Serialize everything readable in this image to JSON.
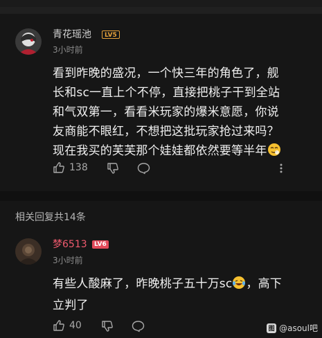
{
  "comment1": {
    "username": "青花瑶池",
    "level_badge": "LV5",
    "time": "3小时前",
    "text_lines": [
      "看到昨晚的盛况，一个快三年的角色了，舰",
      "长和sc一直上个不停，直接把桃子干到全站",
      "和气双第一，看看米玩家的爆米意愿，你说",
      "友商能不眼红，不想把这批玩家抢过来吗？",
      "现在我买的芙芙那个娃娃都依然要等半年"
    ],
    "trailing_emoji": "smug-face-emoji",
    "like_count": "138",
    "icons": [
      "thumbs-up-icon",
      "thumbs-down-icon",
      "comment-bubble-icon",
      "more-vertical-icon"
    ]
  },
  "replies_header": "相关回复共14条",
  "comment2": {
    "username": "梦6513",
    "level_badge": "LV6",
    "time": "3小时前",
    "text_line1_before": "有些人酸麻了，昨晚桃子五十万sc",
    "text_emoji": "laughing-tears-emoji",
    "text_line1_after": "，高下",
    "text_line2": "立判了",
    "like_count": "40",
    "icons": [
      "thumbs-up-icon",
      "thumbs-down-icon",
      "comment-bubble-icon"
    ]
  },
  "watermark": {
    "logo": "图",
    "text": "@asoul吧"
  },
  "colors": {
    "background": "#161616",
    "username1": "#d2d2d2",
    "username2": "#f05a6e",
    "lv5": "#e8a23b",
    "lv6": "#e34a5a"
  }
}
